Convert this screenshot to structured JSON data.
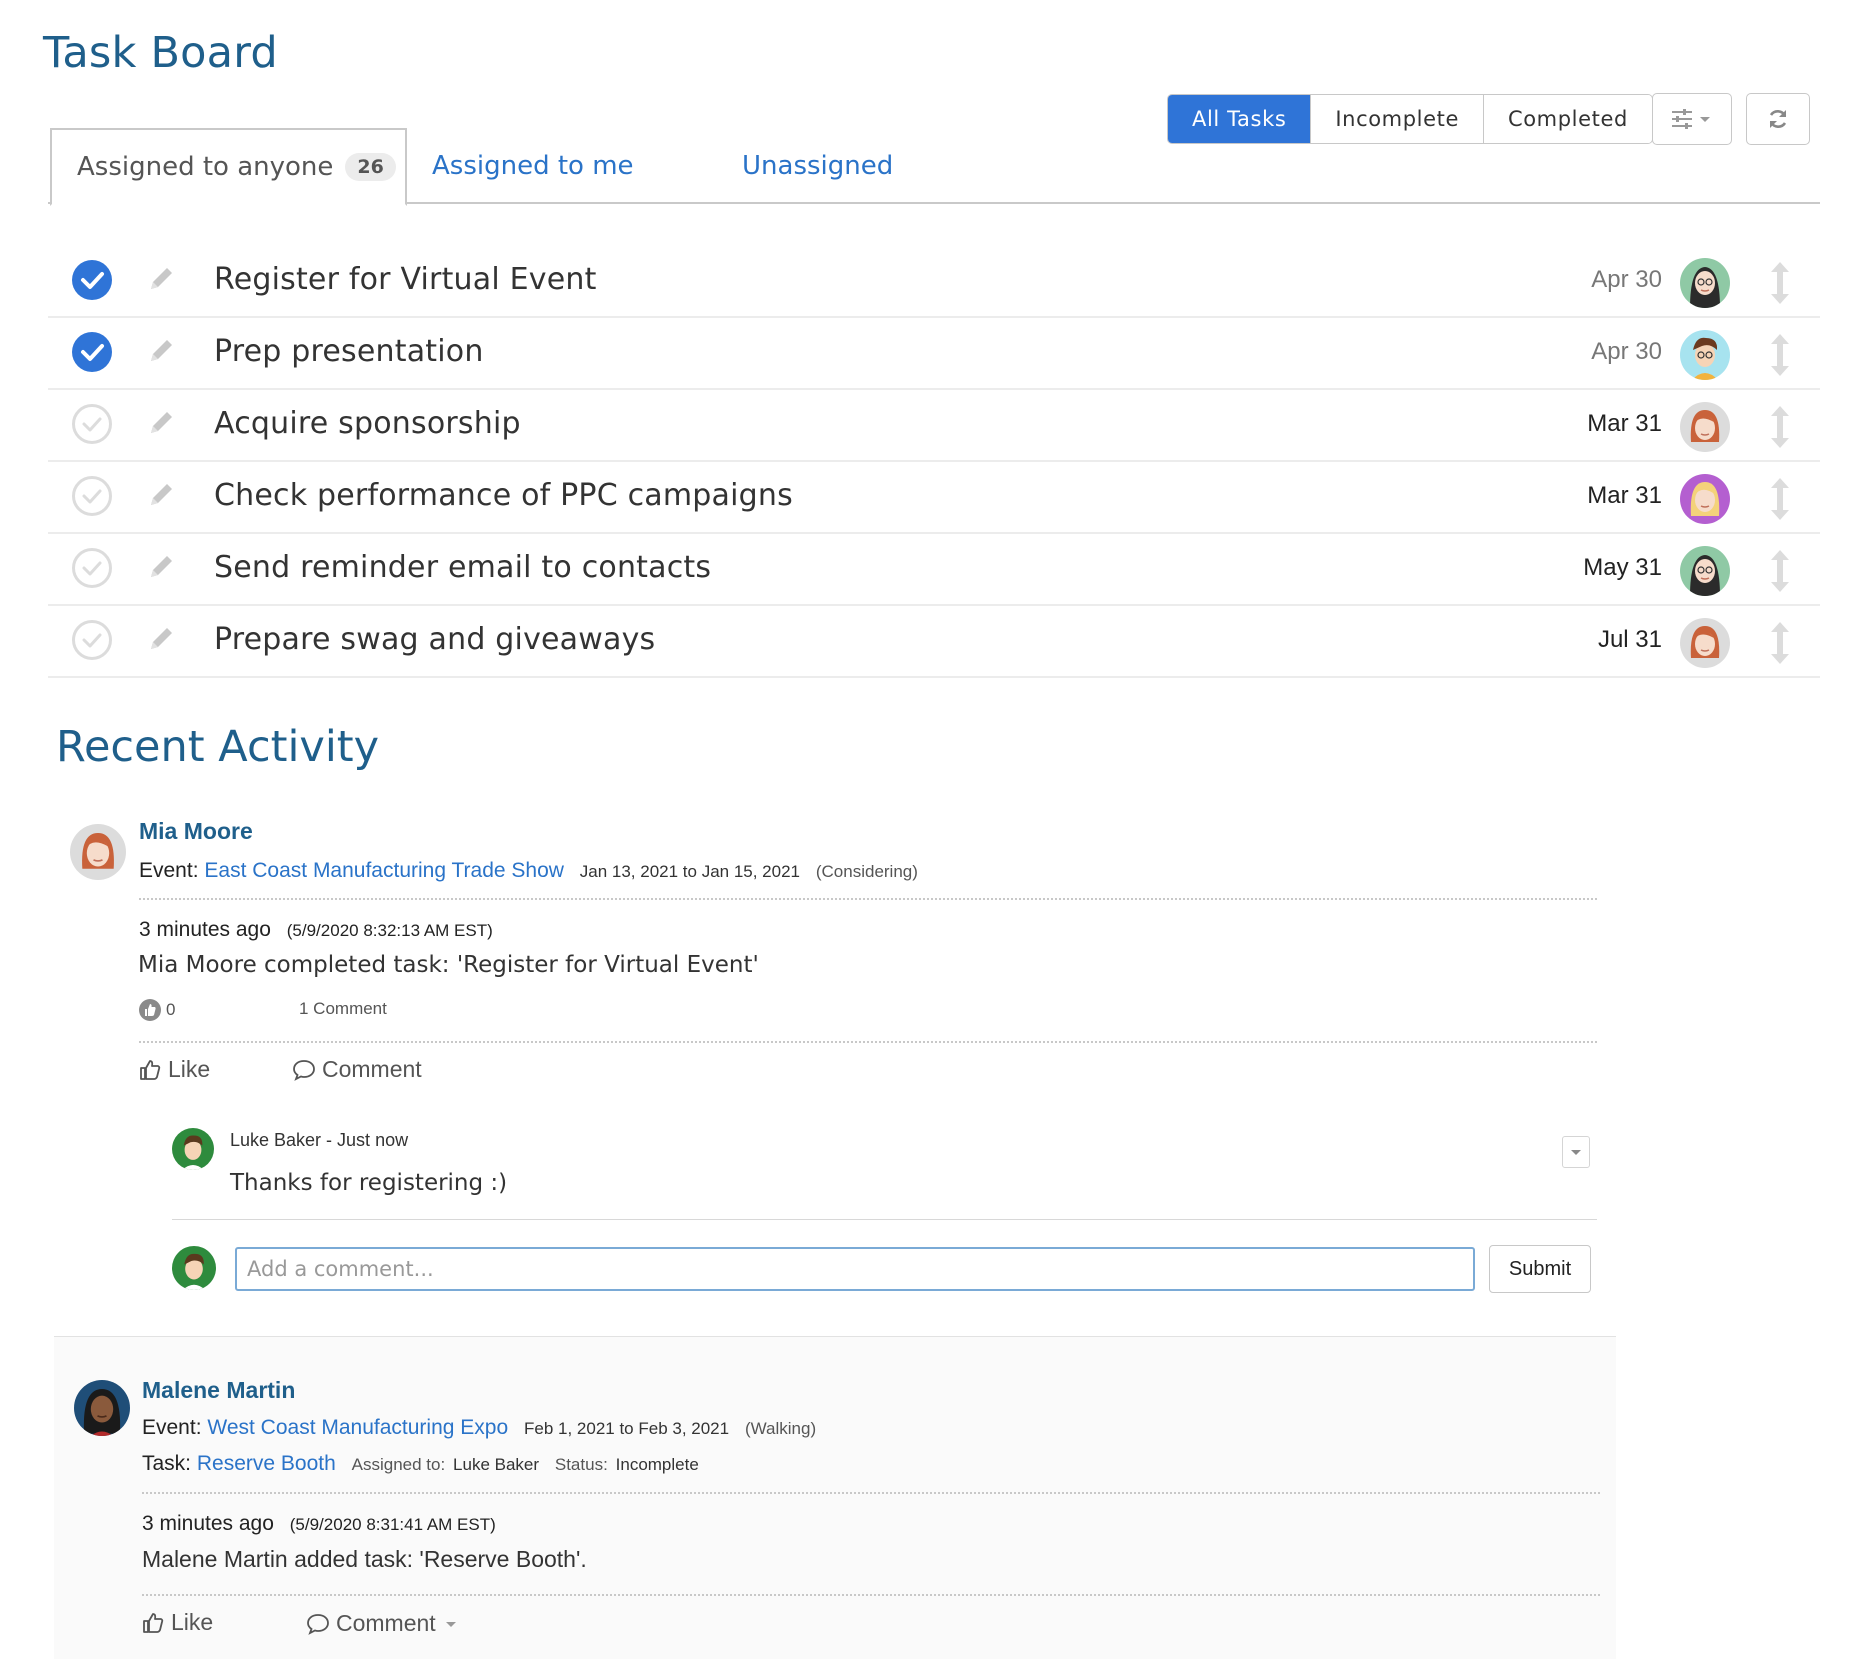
{
  "page_title": "Task Board",
  "filters": [
    {
      "label": "All Tasks",
      "active": true
    },
    {
      "label": "Incomplete",
      "active": false
    },
    {
      "label": "Completed",
      "active": false
    }
  ],
  "tools": {
    "settings_icon": "sliders-icon",
    "refresh_icon": "refresh-icon"
  },
  "tabs": {
    "anyone": {
      "label": "Assigned to anyone",
      "count": "26"
    },
    "me": {
      "label": "Assigned to me"
    },
    "unassigned": {
      "label": "Unassigned"
    }
  },
  "tasks": [
    {
      "title": "Register for Virtual Event",
      "date": "Apr 30",
      "done": true
    },
    {
      "title": "Prep presentation",
      "date": "Apr 30",
      "done": true
    },
    {
      "title": "Acquire sponsorship",
      "date": "Mar 31",
      "done": false
    },
    {
      "title": "Check performance of PPC campaigns",
      "date": "Mar 31",
      "done": false
    },
    {
      "title": "Send reminder email to contacts",
      "date": "May 31",
      "done": false
    },
    {
      "title": "Prepare swag and giveaways",
      "date": "Jul 31",
      "done": false
    }
  ],
  "activity_title": "Recent Activity",
  "activities": [
    {
      "author": "Mia Moore",
      "event_prefix": "Event:",
      "event_name": "East Coast Manufacturing Trade Show",
      "event_dates": "Jan 13, 2021 to Jan 15, 2021",
      "event_status": "(Considering)",
      "relative_time": "3 minutes ago",
      "timestamp": "(5/9/2020 8:32:13 AM EST)",
      "text": "Mia Moore completed task: 'Register for Virtual Event'",
      "like_count": "0",
      "comment_count": "1 Comment",
      "like_label": "Like",
      "comment_label": "Comment",
      "comments": [
        {
          "author": "Luke Baker - Just now",
          "text": "Thanks for registering :)"
        }
      ],
      "comment_placeholder": "Add a comment...",
      "submit_label": "Submit"
    },
    {
      "author": "Malene Martin",
      "event_prefix": "Event:",
      "event_name": "West Coast Manufacturing Expo",
      "event_dates": "Feb 1, 2021 to Feb 3, 2021",
      "event_status": "(Walking)",
      "task_prefix": "Task:",
      "task_name": "Reserve Booth",
      "assigned_label": "Assigned to:",
      "assigned_value": "Luke Baker",
      "status_label": "Status:",
      "status_value": "Incomplete",
      "relative_time": "3 minutes ago",
      "timestamp": "(5/9/2020 8:31:41 AM EST)",
      "text": "Malene Martin added task: 'Reserve Booth'.",
      "like_label": "Like",
      "comment_label": "Comment"
    }
  ]
}
